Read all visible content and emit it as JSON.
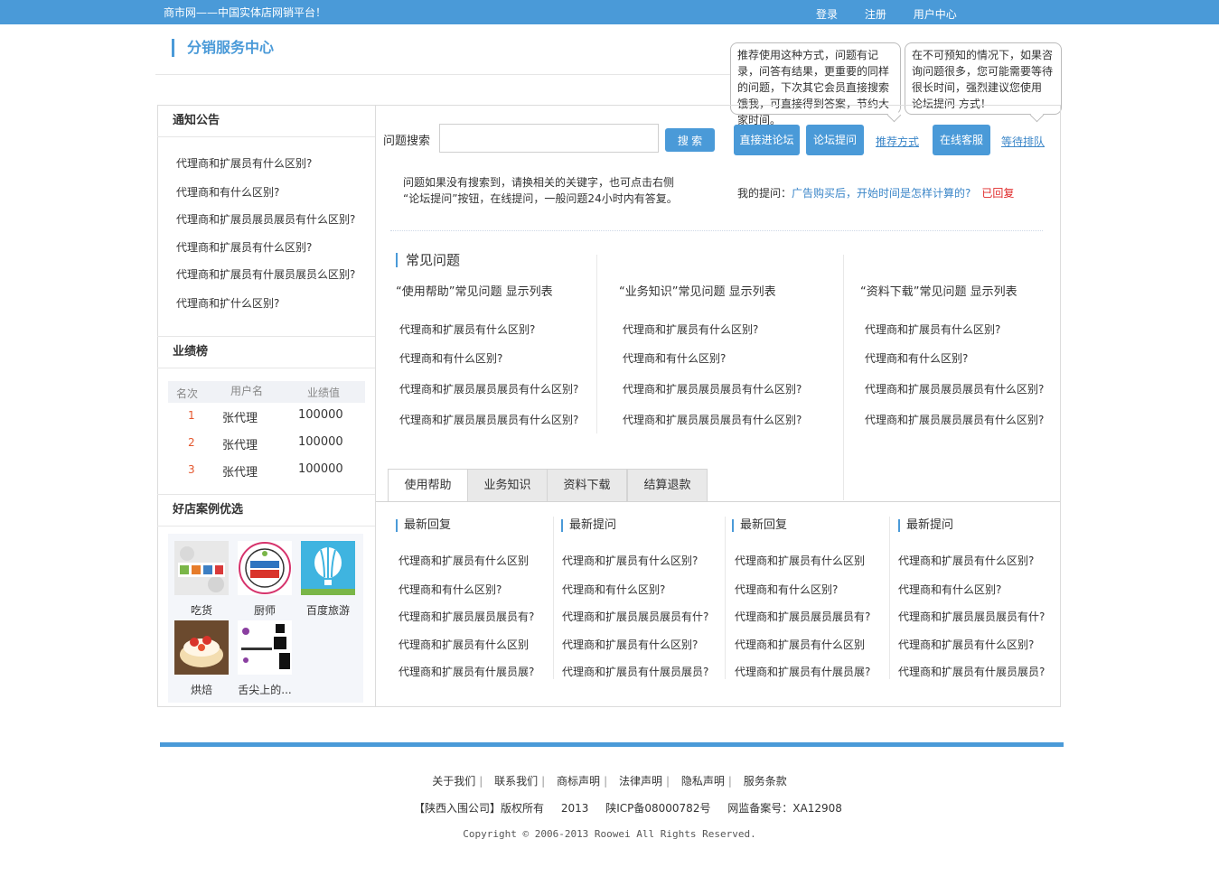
{
  "topbar": {
    "slogan": "商市网——中国实体店网销平台！",
    "login": "登录",
    "register": "注册",
    "user_center": "用户中心"
  },
  "brand": {
    "title": "分销服务中心"
  },
  "bubbles": {
    "recommend": "推荐使用这种方式，问题有记录，问答有结果，更重要的同样的问题，下次其它会员直接搜索饿我，可直接得到答案，节约大家时间。",
    "wait": "在不可预知的情况下，如果咨询问题很多，您可能需要等待很长时间，强烈建议您使用 论坛提问 方式！"
  },
  "notice": {
    "title": "通知公告",
    "items": [
      "代理商和扩展员有什么区别?",
      "代理商和有什么区别?",
      "代理商和扩展员展员展员有什么区别?",
      "代理商和扩展员有什么区别?",
      "代理商和扩展员有什展员展员么区别?",
      "代理商和扩什么区别?"
    ]
  },
  "ranking": {
    "title": "业绩榜",
    "headers": [
      "名次",
      "用户名",
      "业绩值"
    ],
    "rows": [
      [
        "1",
        "张代理",
        "100000"
      ],
      [
        "2",
        "张代理",
        "100000"
      ],
      [
        "3",
        "张代理",
        "100000"
      ]
    ]
  },
  "shops": {
    "title": "好店案例优选",
    "items": [
      "吃货",
      "厨师",
      "百度旅游",
      "烘焙",
      "舌尖上的..."
    ]
  },
  "search": {
    "label": "问题搜索",
    "placeholder": "",
    "button": "搜 索"
  },
  "actions": {
    "forum_direct": "直接进论坛",
    "forum_ask": "论坛提问",
    "recommend_link": "推荐方式",
    "online_service": "在线客服",
    "queue_link": "等待排队"
  },
  "hint": {
    "line1": "问题如果没有搜索到，请换相关的关键字，也可点击右侧",
    "line2": "“论坛提问”按钮，在线提问，一般问题24小时内有答复。"
  },
  "my_question": {
    "label": "我的提问：",
    "question": "广告购买后，开始时间是怎样计算的?",
    "status": "已回复"
  },
  "faq": {
    "title": "常见问题",
    "columns": [
      {
        "heading": "“使用帮助”常见问题 显示列表",
        "items": [
          "代理商和扩展员有什么区别?",
          "代理商和有什么区别?",
          "代理商和扩展员展员展员有什么区别?",
          "代理商和扩展员展员展员有什么区别?"
        ]
      },
      {
        "heading": "“业务知识”常见问题 显示列表",
        "items": [
          "代理商和扩展员有什么区别?",
          "代理商和有什么区别?",
          "代理商和扩展员展员展员有什么区别?",
          "代理商和扩展员展员展员有什么区别?"
        ]
      },
      {
        "heading": "“资料下载”常见问题 显示列表",
        "items": [
          "代理商和扩展员有什么区别?",
          "代理商和有什么区别?",
          "代理商和扩展员展员展员有什么区别?",
          "代理商和扩展员展员展员有什么区别?"
        ]
      }
    ]
  },
  "tabs": [
    "使用帮助",
    "业务知识",
    "资料下载",
    "结算退款"
  ],
  "news": [
    {
      "title": "最新回复",
      "items": [
        "代理商和扩展员有什么区别",
        "代理商和有什么区别?",
        "代理商和扩展员展员展员有?",
        "代理商和扩展员有什么区别",
        "代理商和扩展员有什展员展?"
      ]
    },
    {
      "title": "最新提问",
      "items": [
        "代理商和扩展员有什么区别?",
        "代理商和有什么区别?",
        "代理商和扩展员展员展员有什?",
        "代理商和扩展员有什么区别?",
        "代理商和扩展员有什展员展员?"
      ]
    },
    {
      "title": "最新回复",
      "items": [
        "代理商和扩展员有什么区别",
        "代理商和有什么区别?",
        "代理商和扩展员展员展员有?",
        "代理商和扩展员有什么区别",
        "代理商和扩展员有什展员展?"
      ]
    },
    {
      "title": "最新提问",
      "items": [
        "代理商和扩展员有什么区别?",
        "代理商和有什么区别?",
        "代理商和扩展员展员展员有什?",
        "代理商和扩展员有什么区别?",
        "代理商和扩展员有什展员展员?"
      ]
    }
  ],
  "footer": {
    "links": [
      "关于我们",
      "联系我们",
      "商标声明",
      "法律声明",
      "隐私声明",
      "服务条款"
    ],
    "separator": "|",
    "company": "【陕西入围公司】版权所有",
    "year": "2013",
    "icp": "陕ICP备08000782号",
    "record": "网监备案号：XA12908",
    "copyright": "Copyright © 2006-2013 Roowei All Rights Reserved."
  },
  "colors": {
    "accent": "#4a9ad8",
    "link": "#3b86c8",
    "rank_number": "#e4572e",
    "status_red": "#e02a2a"
  }
}
